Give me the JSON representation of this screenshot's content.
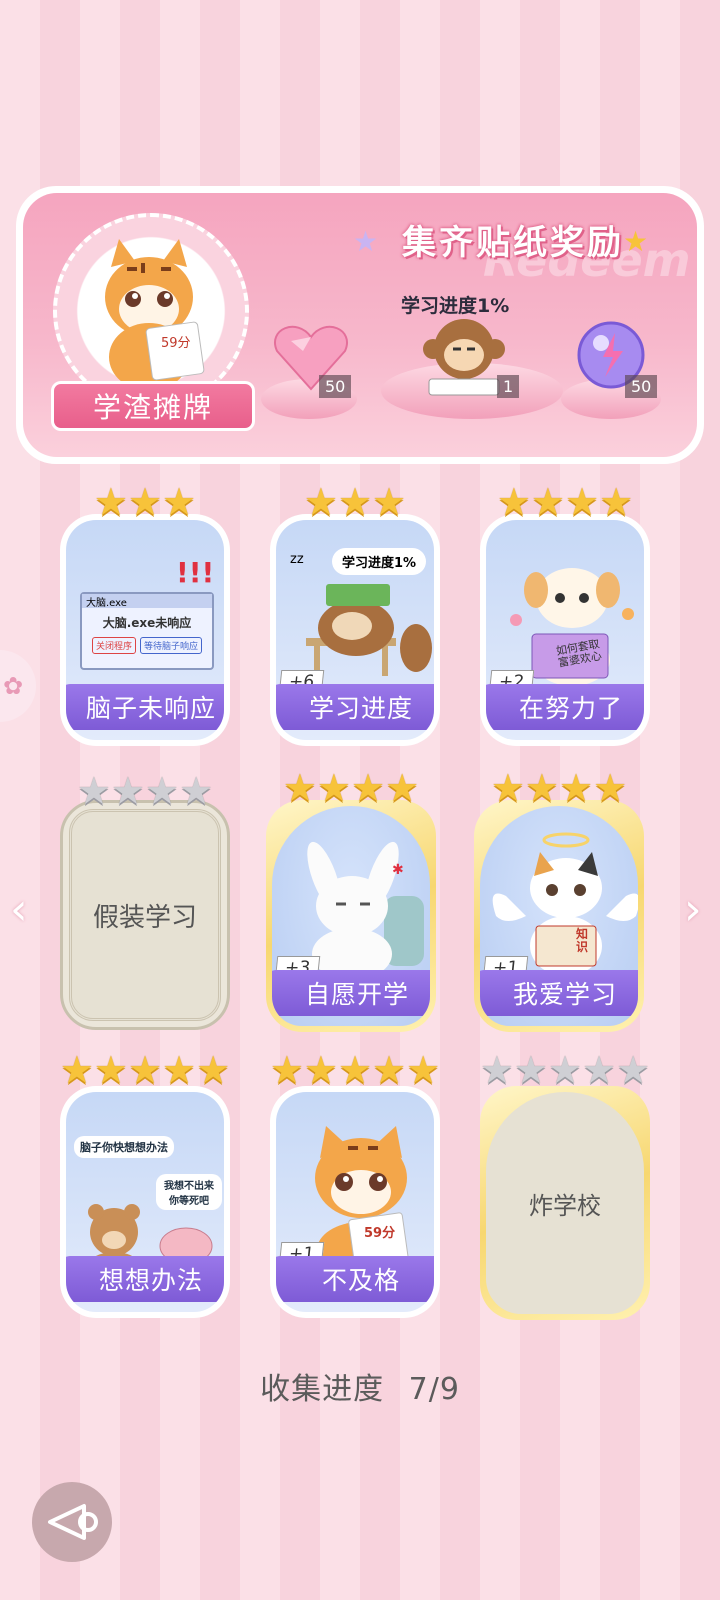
{
  "banner": {
    "title": "集齐贴纸奖励",
    "watermark": "Redeem",
    "label": "学渣摊牌",
    "progress_tag": "学习进度1%"
  },
  "rewards": [
    {
      "name": "heart-gem",
      "count": "50"
    },
    {
      "name": "monkey-sticker",
      "count": "1"
    },
    {
      "name": "energy-orb",
      "count": "50"
    }
  ],
  "tiger_score": "59分",
  "cards": [
    {
      "label": "脑子未响应",
      "stars": 3,
      "max_stars": 3,
      "plus": "",
      "state": "owned",
      "art_text": [
        "大脑.exe",
        "大脑.exe未响应",
        "关闭程序",
        "等待脑子响应"
      ]
    },
    {
      "label": "学习进度",
      "stars": 3,
      "max_stars": 3,
      "plus": "+6",
      "state": "owned",
      "art_text": [
        "学习进度1%",
        "zz"
      ]
    },
    {
      "label": "在努力了",
      "stars": 4,
      "max_stars": 4,
      "plus": "+2",
      "state": "owned",
      "art_text": [
        "如何套取富婆欢心"
      ]
    },
    {
      "label": "假装学习",
      "stars": 0,
      "max_stars": 4,
      "plus": "",
      "state": "locked",
      "art_text": []
    },
    {
      "label": "自愿开学",
      "stars": 4,
      "max_stars": 4,
      "plus": "+3",
      "state": "owned-gold",
      "art_text": []
    },
    {
      "label": "我爱学习",
      "stars": 4,
      "max_stars": 4,
      "plus": "+1",
      "state": "owned-gold",
      "art_text": [
        "知识"
      ]
    },
    {
      "label": "想想办法",
      "stars": 5,
      "max_stars": 5,
      "plus": "",
      "state": "owned",
      "art_text": [
        "脑子你快想想办法",
        "我想不出来你等死吧"
      ]
    },
    {
      "label": "不及格",
      "stars": 5,
      "max_stars": 5,
      "plus": "+1",
      "state": "owned",
      "art_text": [
        "59分"
      ]
    },
    {
      "label": "炸学校",
      "stars": 0,
      "max_stars": 5,
      "plus": "",
      "state": "locked-gold",
      "art_text": []
    }
  ],
  "footer": {
    "progress_label": "收集进度",
    "progress_value": "7/9"
  },
  "nav": {
    "prev": "‹",
    "next": "›"
  }
}
